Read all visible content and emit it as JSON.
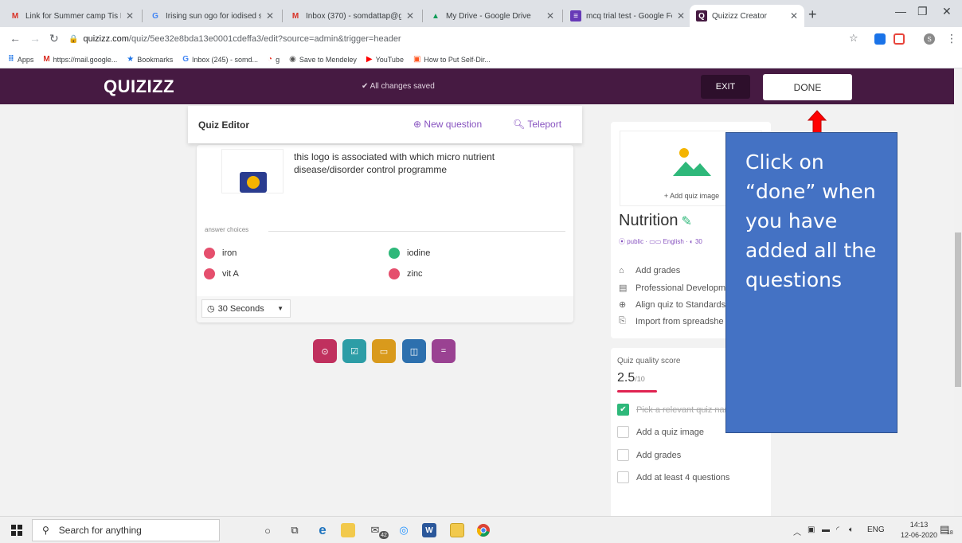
{
  "browser": {
    "tabs": [
      {
        "title": "Link for Summer camp Tis Ec",
        "favicon": "gmail-icon"
      },
      {
        "title": "Irising sun ogo for iodised sa",
        "favicon": "google-icon"
      },
      {
        "title": "Inbox (370) - somdattap@gr",
        "favicon": "gmail-icon"
      },
      {
        "title": "My Drive - Google Drive",
        "favicon": "drive-icon"
      },
      {
        "title": "mcq trial test - Google Form",
        "favicon": "forms-icon"
      },
      {
        "title": "Quizizz Creator",
        "favicon": "quizizz-icon"
      }
    ],
    "url_host": "quizizz.com",
    "url_path": "/quiz/5ee32e8bda13e0001cdeffa3/edit?source=admin&trigger=header",
    "bookmarks": [
      {
        "label": "Apps",
        "icon": "apps-icon"
      },
      {
        "label": "https://mail.google...",
        "icon": "gmail-icon"
      },
      {
        "label": "Bookmarks",
        "icon": "star-icon"
      },
      {
        "label": "Inbox (245) - somd...",
        "icon": "google-icon"
      },
      {
        "label": "g",
        "icon": "colorful-icon"
      },
      {
        "label": "Save to Mendeley",
        "icon": "mendeley-icon"
      },
      {
        "label": "YouTube",
        "icon": "youtube-icon"
      },
      {
        "label": "How to Put Self-Dir...",
        "icon": "page-icon"
      }
    ],
    "profile_initial": "S"
  },
  "header": {
    "logo": "QUIZIZZ",
    "status": "✔ All changes saved",
    "exit_label": "EXIT",
    "done_label": "DONE"
  },
  "editor": {
    "title": "Quiz Editor",
    "new_question": "New question",
    "teleport": "Teleport"
  },
  "question": {
    "text": "this logo is associated with which micro nutrient disease/disorder control programme",
    "answer_choices_label": "answer choices",
    "choices": [
      {
        "label": "iron",
        "correct": false
      },
      {
        "label": "iodine",
        "correct": true
      },
      {
        "label": "vit A",
        "correct": false
      },
      {
        "label": "zinc",
        "correct": false
      }
    ],
    "time": "30 Seconds"
  },
  "colors": {
    "header_bg": "#461a42",
    "accent": "#8854c0",
    "correct": "#2eb87a",
    "incorrect": "#e54f6d",
    "callout": "#4472c4"
  },
  "question_types": [
    {
      "name": "multiple-choice-icon",
      "color": "#c0305e",
      "glyph": "⊙"
    },
    {
      "name": "checkbox-icon",
      "color": "#2d9da6",
      "glyph": "☑"
    },
    {
      "name": "fill-blank-icon",
      "color": "#d99a1c",
      "glyph": "▭"
    },
    {
      "name": "poll-icon",
      "color": "#2d70ae",
      "glyph": "◫"
    },
    {
      "name": "open-ended-icon",
      "color": "#9a4292",
      "glyph": "="
    }
  ],
  "quiz_info": {
    "add_image_label": "+ Add quiz image",
    "name": "Nutrition",
    "meta": "⦿ public · ▭▭ English · ◐ 30",
    "menu": [
      {
        "icon": "grad-cap-icon",
        "glyph": "🎓",
        "label": "Add grades"
      },
      {
        "icon": "book-icon",
        "glyph": "▤",
        "label": "Professional Developm"
      },
      {
        "icon": "plus-circle-icon",
        "glyph": "⊕",
        "label": "Align quiz to Standards"
      },
      {
        "icon": "import-icon",
        "glyph": "⎘",
        "label": "Import from spreadshe"
      }
    ]
  },
  "quality": {
    "title": "Quiz quality score",
    "score": "2.5",
    "out_of": "/10",
    "items": [
      {
        "label": "Pick a relevant quiz name",
        "done": true
      },
      {
        "label": "Add a quiz image",
        "done": false
      },
      {
        "label": "Add grades",
        "done": false
      },
      {
        "label": "Add at least 4 questions",
        "done": false
      }
    ]
  },
  "callout": {
    "text": "Click on “done” when you have added all the questions"
  },
  "taskbar": {
    "search_placeholder": "Search for anything",
    "language": "ENG",
    "time": "14:13",
    "date": "12-06-2020",
    "notification_count": "18",
    "mail_badge": "42"
  }
}
